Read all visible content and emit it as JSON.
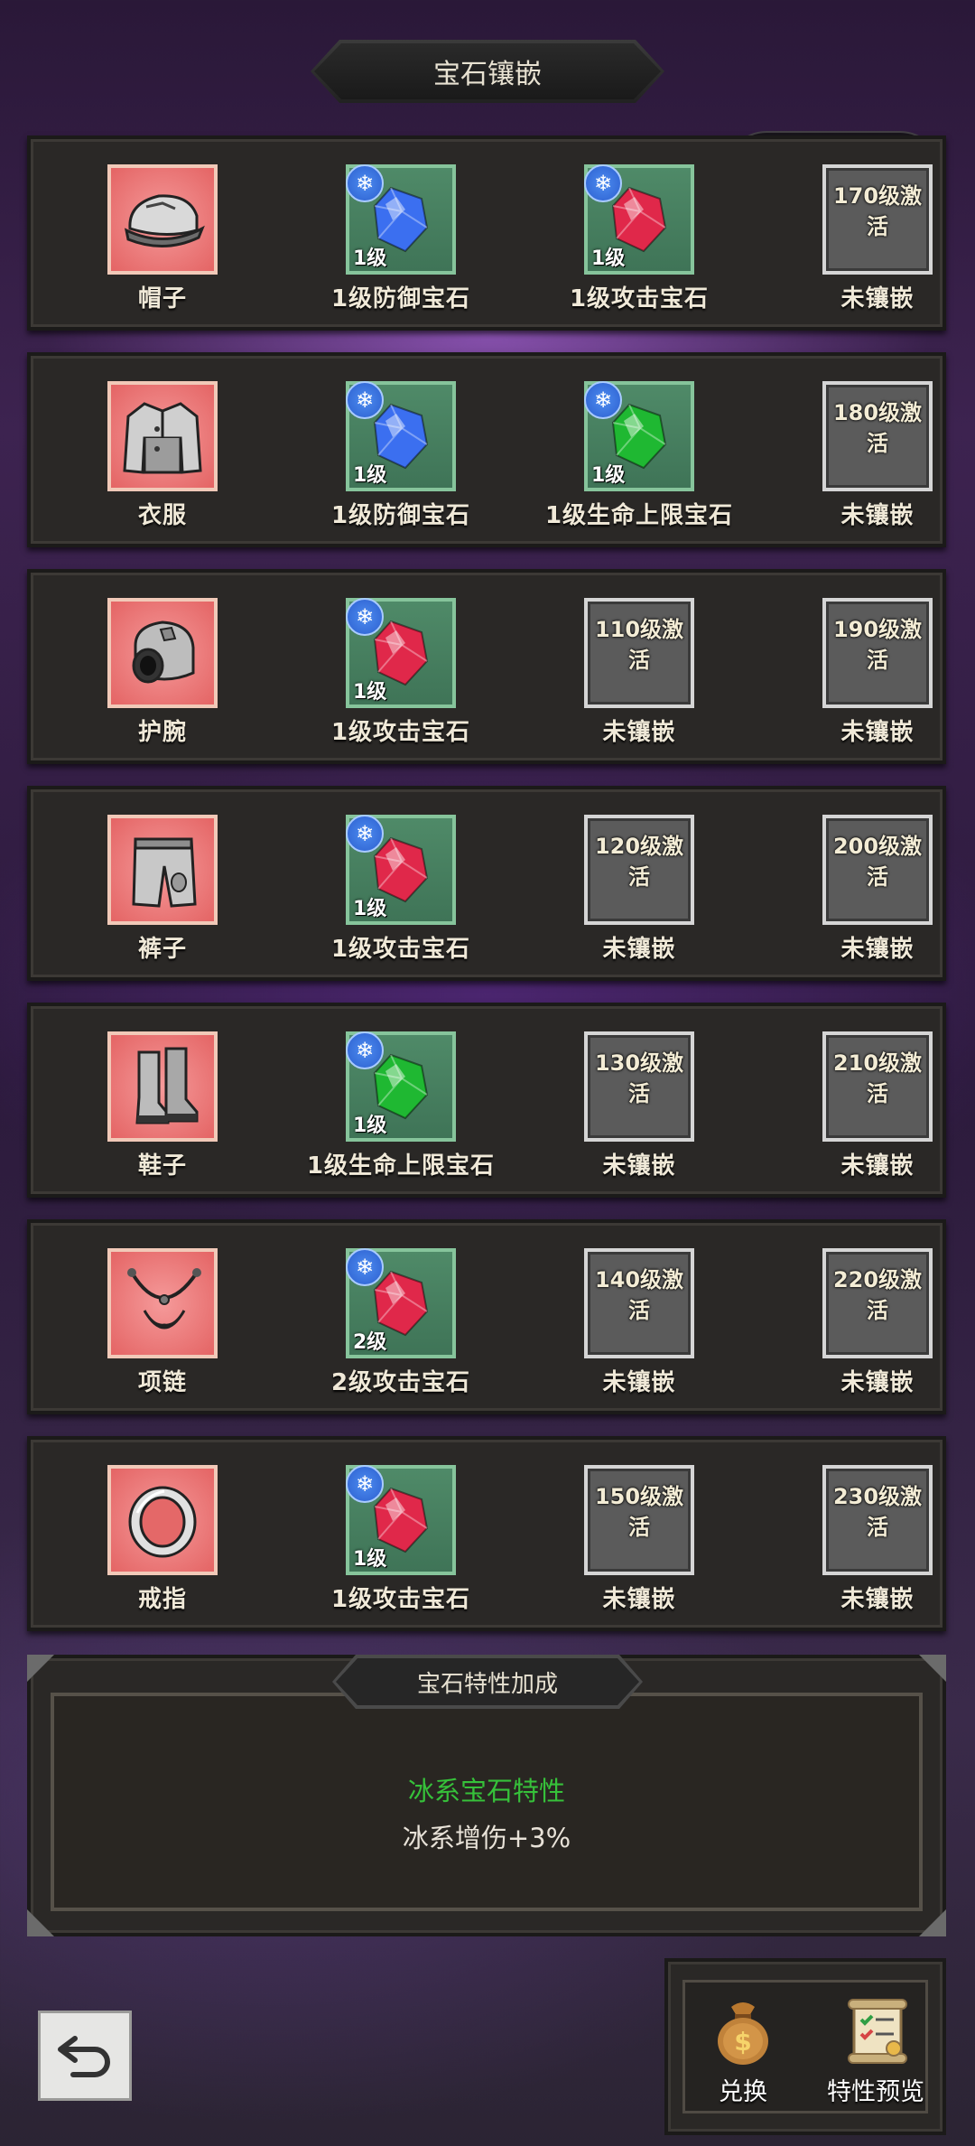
{
  "header": {
    "title": "宝石镶嵌"
  },
  "capsule": {
    "more_icon": "more-dots-icon",
    "close_icon": "target-close-icon"
  },
  "rows": [
    {
      "equipment": {
        "label": "帽子",
        "icon": "hat-icon"
      },
      "slots": [
        {
          "type": "gem",
          "color": "#3b6ff0",
          "level": "1级",
          "label": "1级防御宝石"
        },
        {
          "type": "gem",
          "color": "#e0284a",
          "level": "1级",
          "label": "1级攻击宝石"
        },
        {
          "type": "locked",
          "lock_text": "170级激活",
          "label": "未镶嵌"
        }
      ]
    },
    {
      "equipment": {
        "label": "衣服",
        "icon": "jacket-icon"
      },
      "slots": [
        {
          "type": "gem",
          "color": "#3b6ff0",
          "level": "1级",
          "label": "1级防御宝石"
        },
        {
          "type": "gem",
          "color": "#1fb832",
          "level": "1级",
          "label": "1级生命上限宝石"
        },
        {
          "type": "locked",
          "lock_text": "180级激活",
          "label": "未镶嵌"
        }
      ]
    },
    {
      "equipment": {
        "label": "护腕",
        "icon": "bracer-icon"
      },
      "slots": [
        {
          "type": "gem",
          "color": "#e0284a",
          "level": "1级",
          "label": "1级攻击宝石"
        },
        {
          "type": "locked",
          "lock_text": "110级激活",
          "label": "未镶嵌"
        },
        {
          "type": "locked",
          "lock_text": "190级激活",
          "label": "未镶嵌"
        }
      ]
    },
    {
      "equipment": {
        "label": "裤子",
        "icon": "pants-icon"
      },
      "slots": [
        {
          "type": "gem",
          "color": "#e0284a",
          "level": "1级",
          "label": "1级攻击宝石"
        },
        {
          "type": "locked",
          "lock_text": "120级激活",
          "label": "未镶嵌"
        },
        {
          "type": "locked",
          "lock_text": "200级激活",
          "label": "未镶嵌"
        }
      ]
    },
    {
      "equipment": {
        "label": "鞋子",
        "icon": "boots-icon"
      },
      "slots": [
        {
          "type": "gem",
          "color": "#1fb832",
          "level": "1级",
          "label": "1级生命上限宝石"
        },
        {
          "type": "locked",
          "lock_text": "130级激活",
          "label": "未镶嵌"
        },
        {
          "type": "locked",
          "lock_text": "210级激活",
          "label": "未镶嵌"
        }
      ]
    },
    {
      "equipment": {
        "label": "项链",
        "icon": "necklace-icon"
      },
      "slots": [
        {
          "type": "gem",
          "color": "#e0284a",
          "level": "2级",
          "label": "2级攻击宝石"
        },
        {
          "type": "locked",
          "lock_text": "140级激活",
          "label": "未镶嵌"
        },
        {
          "type": "locked",
          "lock_text": "220级激活",
          "label": "未镶嵌"
        }
      ]
    },
    {
      "equipment": {
        "label": "戒指",
        "icon": "ring-icon"
      },
      "slots": [
        {
          "type": "gem",
          "color": "#e0284a",
          "level": "1级",
          "label": "1级攻击宝石"
        },
        {
          "type": "locked",
          "lock_text": "150级激活",
          "label": "未镶嵌"
        },
        {
          "type": "locked",
          "lock_text": "230级激活",
          "label": "未镶嵌"
        }
      ]
    }
  ],
  "bonus": {
    "title": "宝石特性加成",
    "trait_name": "冰系宝石特性",
    "trait_effect": "冰系增伤+3%",
    "trait_color": "#36c13a"
  },
  "back_button": {
    "icon": "undo-arrow-icon"
  },
  "actions": [
    {
      "label": "兑换",
      "icon": "money-bag-icon"
    },
    {
      "label": "特性预览",
      "icon": "scroll-icon"
    }
  ]
}
